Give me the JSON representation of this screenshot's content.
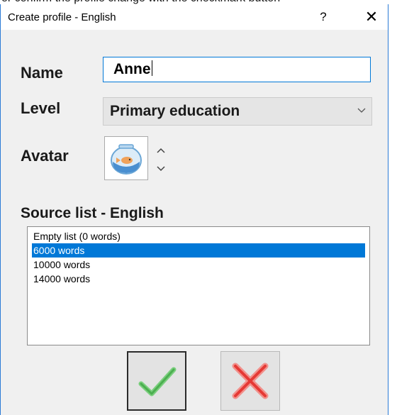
{
  "window": {
    "title": "Create profile - English",
    "help_label": "?",
    "close_label": "✕"
  },
  "form": {
    "name_label": "Name",
    "name_value": "Anne",
    "level_label": "Level",
    "level_value": "Primary education",
    "avatar_label": "Avatar",
    "avatar_icon": "goldfish-bowl-icon"
  },
  "source": {
    "heading": "Source list - English",
    "items": [
      "Empty list (0 words)",
      "6000 words",
      "10000 words",
      "14000 words"
    ],
    "selected_index": 1
  },
  "buttons": {
    "ok_icon": "checkmark-icon",
    "cancel_icon": "red-x-icon"
  },
  "colors": {
    "accent": "#0078d7",
    "ok_green": "#4caf50",
    "cancel_red": "#e53935"
  }
}
